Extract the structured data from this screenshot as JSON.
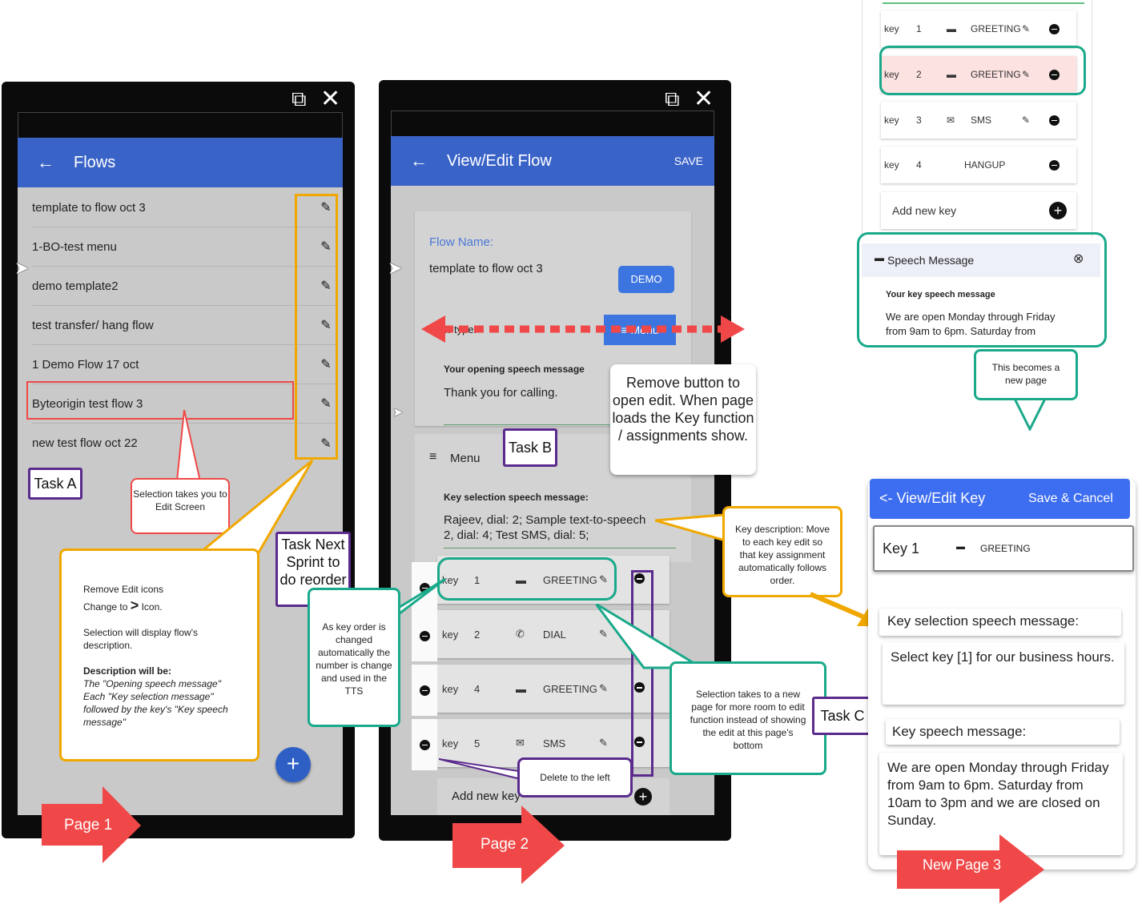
{
  "page1": {
    "appbar_title": "Flows",
    "flows": [
      "template to flow oct 3",
      "1-BO-test menu",
      "demo template2",
      "test transfer/ hang flow",
      "1 Demo Flow 17 oct",
      "Byteorigin test flow 3",
      "new test flow oct 22"
    ],
    "fab_label": "+",
    "arrow_label": "Page 1"
  },
  "page2": {
    "appbar_title": "View/Edit Flow",
    "save_label": "SAVE",
    "flow_name_label": "Flow Name:",
    "flow_name_value": "template to flow oct 3",
    "demo_button": "DEMO",
    "type_label": "Flow type:",
    "menu_button": "≡ Menu",
    "opening_label": "Your opening speech message",
    "opening_value": "Thank you for calling.",
    "menu_section": "Menu",
    "key_sel_label": "Key selection speech message:",
    "key_sel_value_1": "Rajeev, dial: 2; Sample text-to-speech",
    "key_sel_value_2": "2, dial: 4; Test SMS, dial: 5;",
    "keys": [
      {
        "label": "key",
        "num": "1",
        "type": "GREETING"
      },
      {
        "label": "key",
        "num": "2",
        "type": "DIAL"
      },
      {
        "label": "key",
        "num": "4",
        "type": "GREETING"
      },
      {
        "label": "key",
        "num": "5",
        "type": "SMS"
      }
    ],
    "add_key": "Add new key",
    "arrow_label": "Page 2"
  },
  "right_panel": {
    "keys": [
      {
        "label": "key",
        "num": "1",
        "type": "GREETING"
      },
      {
        "label": "key",
        "num": "2",
        "type": "GREETING"
      },
      {
        "label": "key",
        "num": "3",
        "type": "SMS"
      },
      {
        "label": "key",
        "num": "4",
        "type": "HANGUP"
      }
    ],
    "add_key": "Add new key",
    "speech_title": "Speech Message",
    "speech_label": "Your key speech message",
    "speech_value_1": "We are open Monday through Friday",
    "speech_value_2": "from 9am to 6pm. Saturday from",
    "becomes_page": "This becomes a new page"
  },
  "page3": {
    "back_title": "<- View/Edit Key",
    "save_cancel": "Save  & Cancel",
    "key_title": "Key 1",
    "key_type": "GREETING",
    "key_sel_label": "Key selection speech message:",
    "key_sel_value": "Select key [1] for our business hours.",
    "key_speech_label": "Key speech message:",
    "key_speech_value": "We are open Monday through Friday from 9am to 6pm. Saturday from 10am to 3pm and we are closed on Sunday.",
    "arrow_label": "New Page 3"
  },
  "annotations": {
    "task_a": "Task A",
    "task_b": "Task B",
    "task_c": "Task C",
    "task_next": "Task Next Sprint to do reorder",
    "selection_edit": "Selection takes you to Edit Screen",
    "remove_edit_1": "Remove Edit icons",
    "remove_edit_2": "Change to",
    "remove_edit_2b": "Icon.",
    "remove_edit_3": "Selection will display flow's description.",
    "remove_edit_4": "Description will be:",
    "remove_edit_5": "The \"Opening speech message\" Each \"Key selection message\" followed by the key's \"Key speech message\"",
    "remove_button": "Remove button to open edit. When page loads the Key function / assignments show.",
    "key_order": "As key order is changed automatically the number is change and used in the TTS",
    "key_desc": "Key description: Move to each key edit so that key assignment automatically follows order.",
    "selection_new_page": "Selection takes to a new page for more room to edit function instead of showing the edit at this page's bottom",
    "delete_left": "Delete to the left"
  },
  "colors": {
    "appbar": "#3a63c8",
    "orange": "#f0a800",
    "teal": "#1aa98a",
    "purple": "#5a2a8c",
    "red": "#f04848",
    "highlight": "#fde2e2"
  }
}
